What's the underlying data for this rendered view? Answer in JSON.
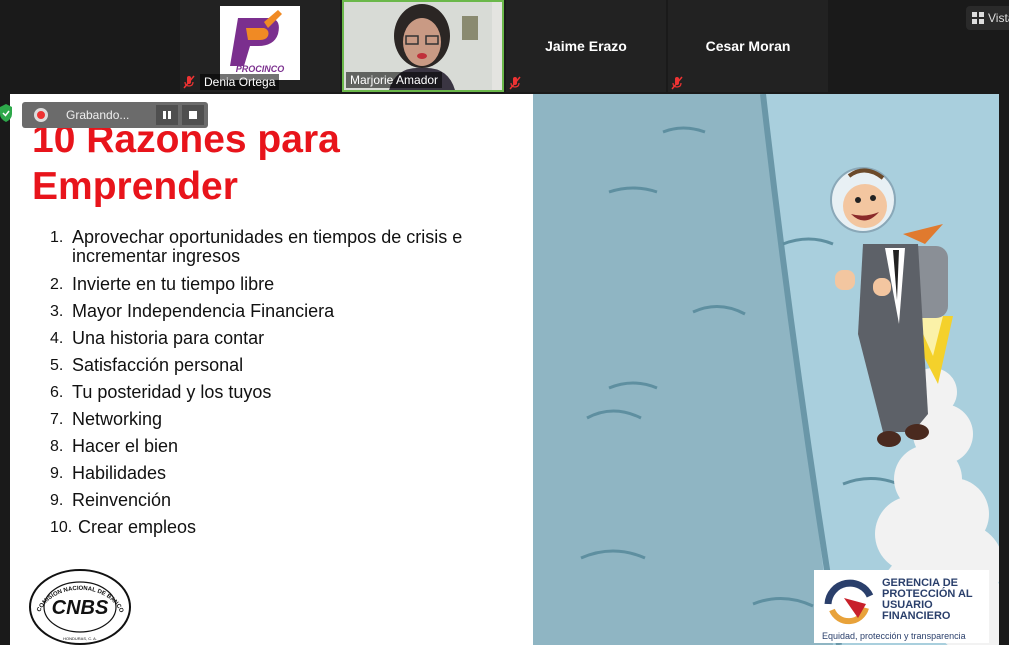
{
  "participants": [
    {
      "name": "Denia Ortega",
      "logo_text": "PROCINCO",
      "muted": true
    },
    {
      "name": "Marjorie Amador",
      "muted": false
    },
    {
      "name": "Jaime Erazo",
      "muted": true
    },
    {
      "name": "Cesar Moran",
      "muted": true
    }
  ],
  "view_button": {
    "label": "Vista"
  },
  "recording": {
    "label": "Grabando...",
    "pause_icon": "pause-icon",
    "stop_icon": "stop-icon"
  },
  "slide": {
    "title": "10 Razones para Emprender",
    "reasons": [
      {
        "num": "1.",
        "text": "Aprovechar oportunidades en tiempos de crisis e incrementar ingresos"
      },
      {
        "num": "2.",
        "text": "Invierte en tu tiempo libre"
      },
      {
        "num": "3.",
        "text": " Mayor Independencia Financiera"
      },
      {
        "num": "4.",
        "text": " Una historia para contar"
      },
      {
        "num": "5.",
        "text": " Satisfacción personal"
      },
      {
        "num": "6.",
        "text": " Tu posteridad y los tuyos"
      },
      {
        "num": "7.",
        "text": " Networking"
      },
      {
        "num": "8.",
        "text": " Hacer el bien"
      },
      {
        "num": "9.",
        "text": " Habilidades"
      },
      {
        "num": "9.",
        "text": "Reinvención"
      },
      {
        "num": "10.",
        "text": "Crear empleos"
      }
    ],
    "logo_left": "CNBS",
    "logo_left_ring": "COMISION NACIONAL DE BANCOS Y SEGUROS",
    "logo_left_sub": "HONDURAS, C. A.",
    "logo_right_lines": [
      "GERENCIA DE",
      "PROTECCIÓN AL",
      "USUARIO",
      "FINANCIERO"
    ],
    "logo_right_tagline": "Equidad, protección y transparencia"
  },
  "colors": {
    "title": "#e8141b",
    "slide_bg_right": "#8fb5c3",
    "speaker_border": "#6bb84a"
  }
}
